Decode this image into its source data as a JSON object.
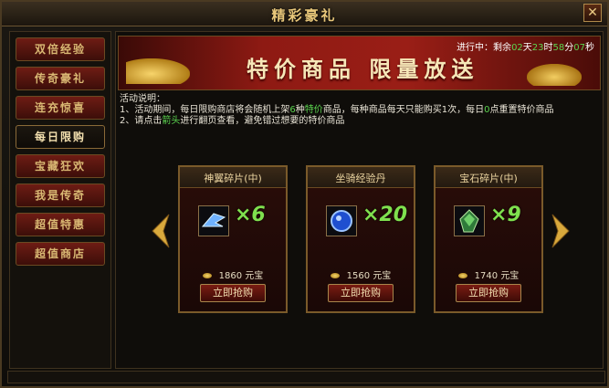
{
  "window": {
    "title": "精彩豪礼",
    "close_icon": "close-icon"
  },
  "sidebar": {
    "items": [
      {
        "label": "双倍经验",
        "active": false
      },
      {
        "label": "传奇豪礼",
        "active": false
      },
      {
        "label": "连充惊喜",
        "active": false
      },
      {
        "label": "每日限购",
        "active": true
      },
      {
        "label": "宝藏狂欢",
        "active": false
      },
      {
        "label": "我是传奇",
        "active": false
      },
      {
        "label": "超值特惠",
        "active": false
      },
      {
        "label": "超值商店",
        "active": false
      }
    ]
  },
  "banner": {
    "text": "特价商品 限量放送",
    "countdown": {
      "prefix": "进行中：剩余",
      "days": "02",
      "days_unit": "天",
      "hours": "23",
      "hours_unit": "时",
      "minutes": "58",
      "minutes_unit": "分",
      "seconds": "07",
      "seconds_unit": "秒"
    }
  },
  "description": {
    "title": "活动说明：",
    "line1_a": "1、活动期间，每日限购商店将会随机上架",
    "line1_num": "6",
    "line1_b": "种",
    "line1_c": "特价",
    "line1_d": "商品，每种商品每天只能购买1次，每日",
    "line1_e": "0",
    "line1_f": "点重置特价商品",
    "line2_a": "2、请点击",
    "line2_b": "箭头",
    "line2_c": "进行翻页查看，避免错过想要的特价商品"
  },
  "products": [
    {
      "name": "神翼碎片(中)",
      "qty": "×6",
      "price": "1860",
      "currency": "元宝",
      "button": "立即抢购",
      "icon": "wing-shard-icon"
    },
    {
      "name": "坐骑经验丹",
      "qty": "×20",
      "price": "1560",
      "currency": "元宝",
      "button": "立即抢购",
      "icon": "mount-exp-pill-icon"
    },
    {
      "name": "宝石碎片(中)",
      "qty": "×9",
      "price": "1740",
      "currency": "元宝",
      "button": "立即抢购",
      "icon": "gem-shard-icon"
    }
  ],
  "colors": {
    "accent_gold": "#e8c77a",
    "qty_green": "#7fe04e",
    "highlight_green": "#5bd44f",
    "button_red": "#7a1c12"
  }
}
